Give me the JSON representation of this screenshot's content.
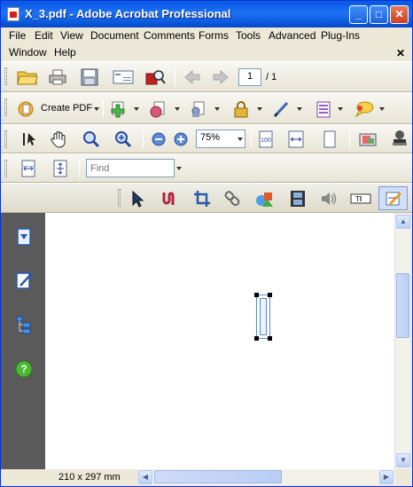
{
  "window": {
    "title": "X_3.pdf - Adobe Acrobat Professional",
    "controls": {
      "minimize": "_",
      "maximize": "□",
      "close": "✕"
    }
  },
  "menu": {
    "row1": [
      "File",
      "Edit",
      "View",
      "Document",
      "Comments",
      "Forms",
      "Tools",
      "Advanced",
      "Plug-Ins"
    ],
    "row2": [
      "Window",
      "Help"
    ],
    "close_doc": "✕"
  },
  "toolbar_file": {
    "icons": [
      "open-folder-icon",
      "print-icon",
      "save-icon",
      "email-icon",
      "search-icon"
    ],
    "page_number": "1",
    "page_total": "/ 1"
  },
  "toolbar_tasks": {
    "create_pdf_label": "Create PDF",
    "icons": [
      "create-pdf-icon",
      "combine-files-icon",
      "export-icon",
      "review-comment-icon",
      "secure-lock-icon",
      "sign-pen-icon",
      "forms-icon",
      "comment-balloon-icon"
    ]
  },
  "toolbar_view": {
    "icons": [
      "select-text-icon",
      "hand-icon",
      "marquee-zoom-icon",
      "zoom-in-tool-icon",
      "zoom-out-icon",
      "zoom-in-icon",
      "actual-size-icon",
      "fit-width-icon",
      "fit-page-icon",
      "snapshot-icon",
      "stamp-icon"
    ],
    "zoom_value": "75%"
  },
  "toolbar_find": {
    "find_placeholder": "Find",
    "icons": [
      "fit-width-page-icon",
      "fit-page-view-icon"
    ]
  },
  "toolbar_advanced": {
    "icons": [
      "select-object-icon",
      "link-tool-icon",
      "crop-icon",
      "chain-link-icon",
      "3d-tool-icon",
      "movie-icon",
      "sound-icon",
      "text-field-icon",
      "edit-form-icon"
    ]
  },
  "navigation": {
    "icons": [
      "pages-icon",
      "signatures-icon",
      "layers-icon",
      "help-icon"
    ]
  },
  "status": {
    "page_size": "210 x 297 mm"
  }
}
